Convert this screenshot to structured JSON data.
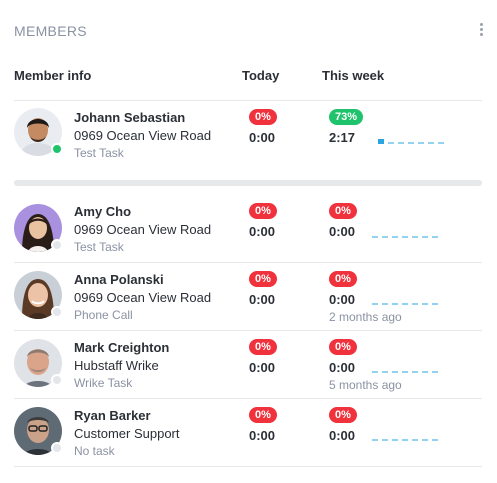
{
  "panel": {
    "title": "MEMBERS"
  },
  "columns": {
    "member": "Member info",
    "today": "Today",
    "week": "This week"
  },
  "members": [
    {
      "name": "Johann Sebastian",
      "project": "0969 Ocean View Road",
      "task": "Test Task",
      "status": "online",
      "today_pct": "0%",
      "today_time": "0:00",
      "week_pct": "73%",
      "week_time": "2:17",
      "last_active": ""
    },
    {
      "name": "Amy Cho",
      "project": "0969 Ocean View Road",
      "task": "Test Task",
      "status": "offline",
      "today_pct": "0%",
      "today_time": "0:00",
      "week_pct": "0%",
      "week_time": "0:00",
      "last_active": ""
    },
    {
      "name": "Anna Polanski",
      "project": "0969 Ocean View Road",
      "task": "Phone Call",
      "status": "offline",
      "today_pct": "0%",
      "today_time": "0:00",
      "week_pct": "0%",
      "week_time": "0:00",
      "last_active": "2 months ago"
    },
    {
      "name": "Mark Creighton",
      "project": "Hubstaff Wrike",
      "task": "Wrike Task",
      "status": "offline",
      "today_pct": "0%",
      "today_time": "0:00",
      "week_pct": "0%",
      "week_time": "0:00",
      "last_active": "5 months ago"
    },
    {
      "name": "Ryan Barker",
      "project": "Customer Support",
      "task": "No task",
      "status": "offline",
      "today_pct": "0%",
      "today_time": "0:00",
      "week_pct": "0%",
      "week_time": "0:00",
      "last_active": ""
    }
  ],
  "colors": {
    "online": "#1fc36b",
    "danger": "#f0323d",
    "success": "#1fc36b",
    "spark": "#2aa5e3"
  }
}
